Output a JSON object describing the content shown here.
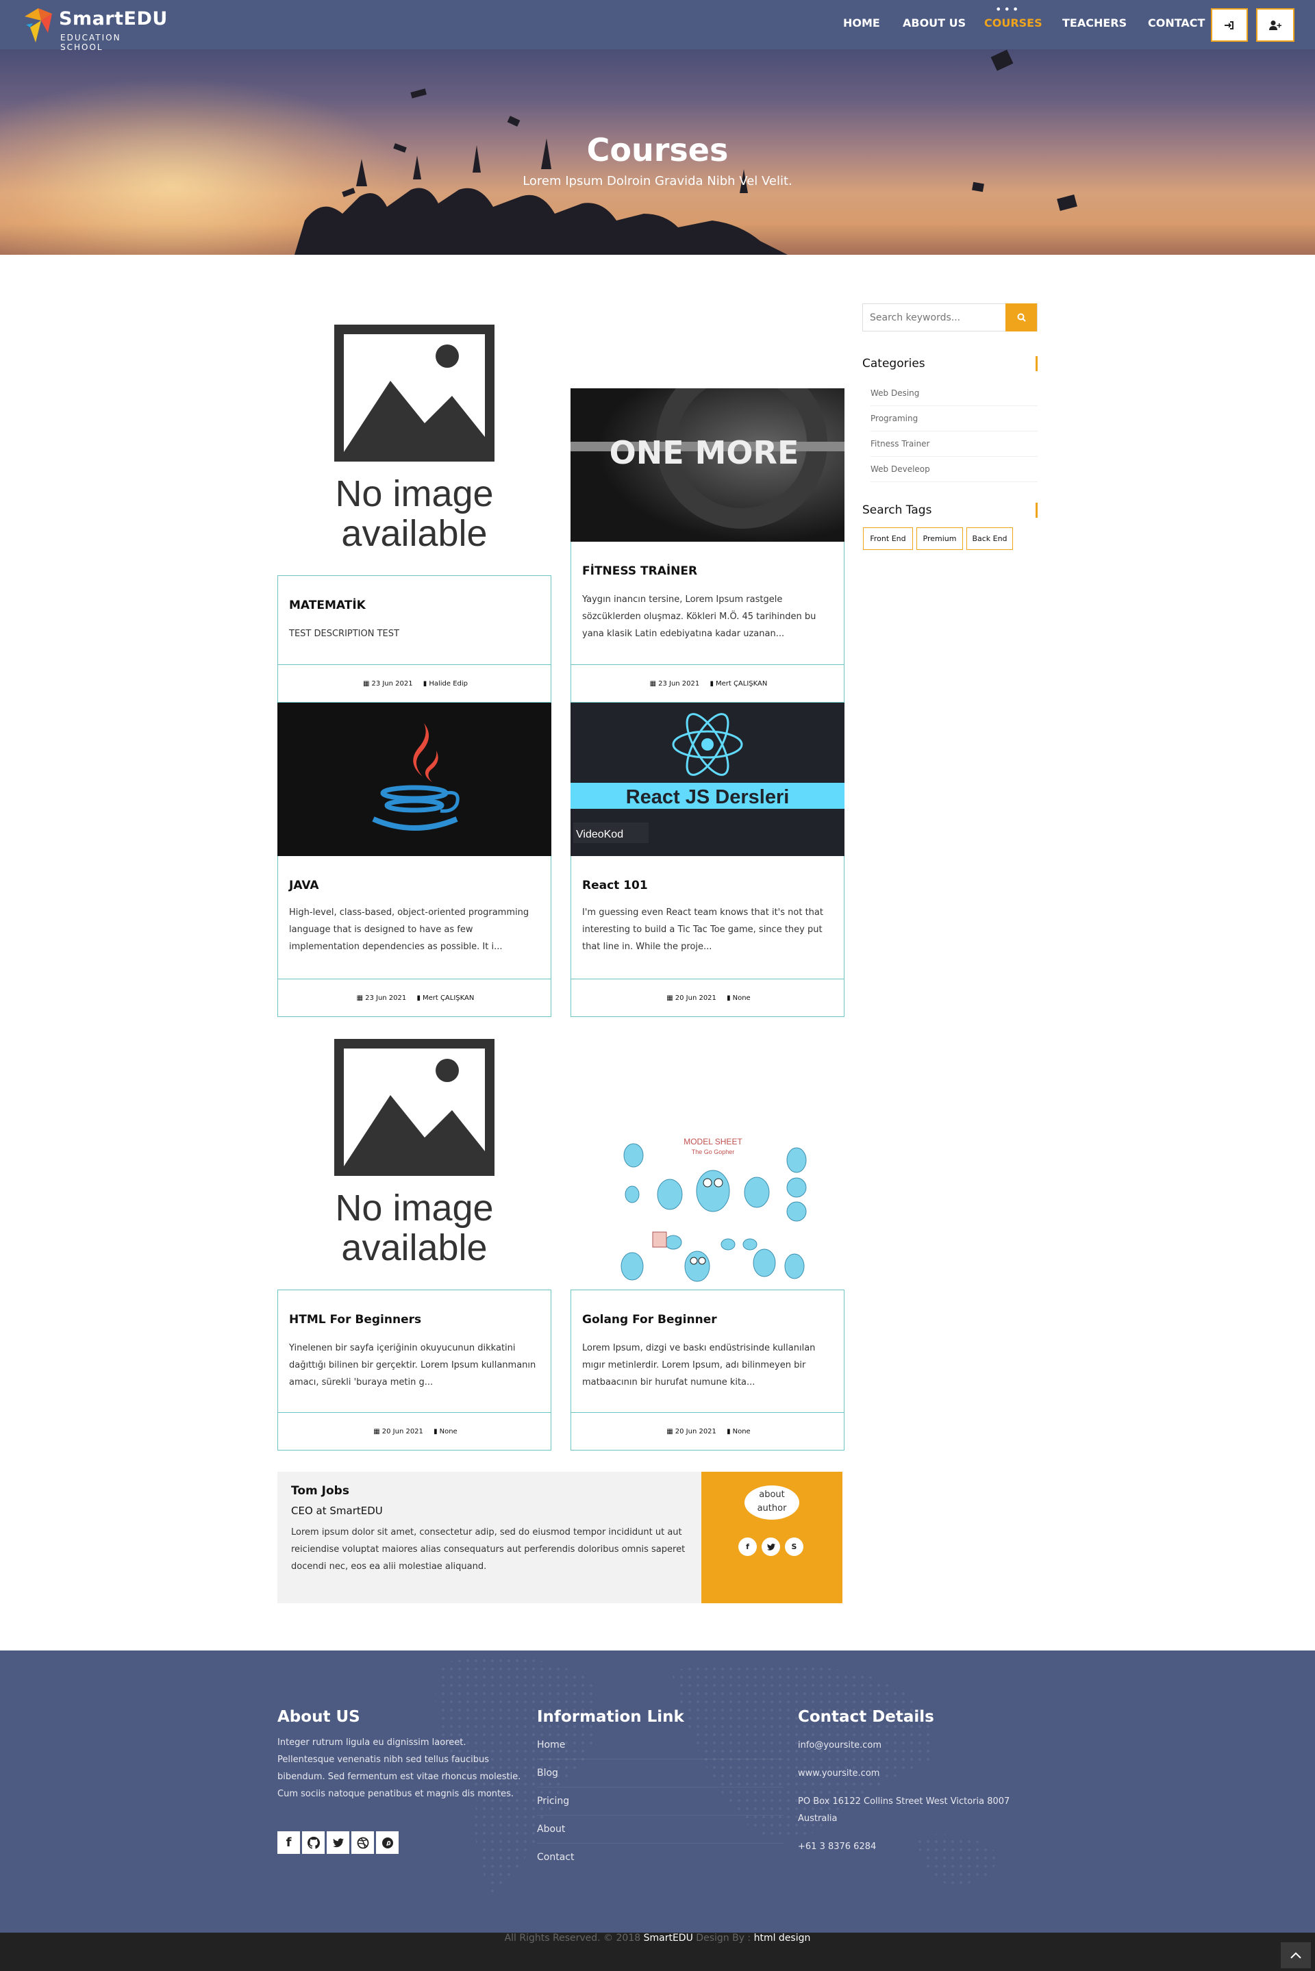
{
  "brand": {
    "name": "SmartEDU",
    "tagline": "EDUCATION SCHOOL"
  },
  "nav": {
    "items": [
      {
        "label": "HOME"
      },
      {
        "label": "ABOUT US"
      },
      {
        "label": "COURSES",
        "active": true
      },
      {
        "label": "TEACHERS"
      },
      {
        "label": "CONTACT"
      }
    ],
    "login_icon": "sign-in-icon",
    "register_icon": "user-plus-icon"
  },
  "banner": {
    "title": "Courses",
    "subtitle": "Lorem Ipsum Dolroin Gravida Nibh Vel Velit."
  },
  "courses": [
    {
      "title": "MATEMATİK",
      "desc": "TEST DESCRIPTION TEST",
      "date": "23 Jun 2021",
      "author": "Halide Edip",
      "image": "No image available"
    },
    {
      "title": "FİTNESS TRAİNER",
      "desc": "Yaygın inancın tersine, Lorem Ipsum rastgele sözcüklerden oluşmaz. Kökleri M.Ö. 45 tarihinden bu yana klasik Latin edebiyatına kadar uzanan...",
      "date": "23 Jun 2021",
      "author": "Mert ÇALIŞKAN",
      "image": "ONE MORE"
    },
    {
      "title": "JAVA",
      "desc": "High-level, class-based, object-oriented programming language that is designed to have as few implementation dependencies as possible. It i...",
      "date": "23 Jun 2021",
      "author": "Mert ÇALIŞKAN",
      "image": "java-logo"
    },
    {
      "title": "React 101",
      "desc": "I'm guessing even React team knows that it's not that interesting to build a Tic Tac Toe game, since they put that line in. While the proje...",
      "date": "20 Jun 2021",
      "author": "None",
      "image": "React JS Dersleri",
      "image_brand": "VideoKod"
    },
    {
      "title": "HTML For Beginners",
      "desc": "Yinelenen bir sayfa içeriğinin okuyucunun dikkatini dağıttığı bilinen bir gerçektir. Lorem Ipsum kullanmanın amacı, sürekli 'buraya metin g...",
      "date": "20 Jun 2021",
      "author": "None",
      "image": "No image available"
    },
    {
      "title": "Golang For Beginner",
      "desc": "Lorem Ipsum, dizgi ve baskı endüstrisinde kullanılan mıgır metinlerdir. Lorem Ipsum, adı bilinmeyen bir matbaacının bir hurufat numune kita...",
      "date": "20 Jun 2021",
      "author": "None",
      "image": "MODEL SHEET",
      "image_sub": "The Go Gopher"
    }
  ],
  "sidebar": {
    "search_placeholder": "Search keywords...",
    "categories_title": "Categories",
    "categories": [
      "Web Desing",
      "Programing",
      "Fitness Trainer",
      "Web Develeop"
    ],
    "tags_title": "Search Tags",
    "tags": [
      "Front End",
      "Premium",
      "Back End"
    ]
  },
  "author_box": {
    "name": "Tom Jobs",
    "role": "CEO at SmartEDU",
    "bio": "Lorem ipsum dolor sit amet, consectetur adip, sed do eiusmod tempor incididunt ut aut reiciendise voluptat maiores alias consequaturs aut perferendis doloribus omnis saperet docendi nec, eos ea alii molestiae aliquand.",
    "image_alt": "about author",
    "social": [
      "facebook-icon",
      "twitter-icon",
      "skype-icon"
    ]
  },
  "footer": {
    "about_title": "About US",
    "about_text": "Integer rutrum ligula eu dignissim laoreet. Pellentesque venenatis nibh sed tellus faucibus bibendum. Sed fermentum est vitae rhoncus molestie. Cum sociis natoque penatibus et magnis dis montes.",
    "social": [
      "facebook-icon",
      "github-icon",
      "twitter-icon",
      "dribbble-icon",
      "pinterest-icon"
    ],
    "links_title": "Information Link",
    "links": [
      "Home",
      "Blog",
      "Pricing",
      "About",
      "Contact"
    ],
    "contact_title": "Contact Details",
    "contact": [
      "info@yoursite.com",
      "www.yoursite.com",
      "PO Box 16122 Collins Street West Victoria 8007 Australia",
      "+61 3 8376 6284"
    ]
  },
  "copyright": {
    "prefix": "All Rights Reserved. © 2018",
    "brand": "SmartEDU",
    "middle": "Design By :",
    "designer": "html design"
  },
  "colors": {
    "header": "#4d5a82",
    "accent": "#f0a41c",
    "card_border": "#6cc4c4",
    "copyright_bg": "#222222"
  }
}
